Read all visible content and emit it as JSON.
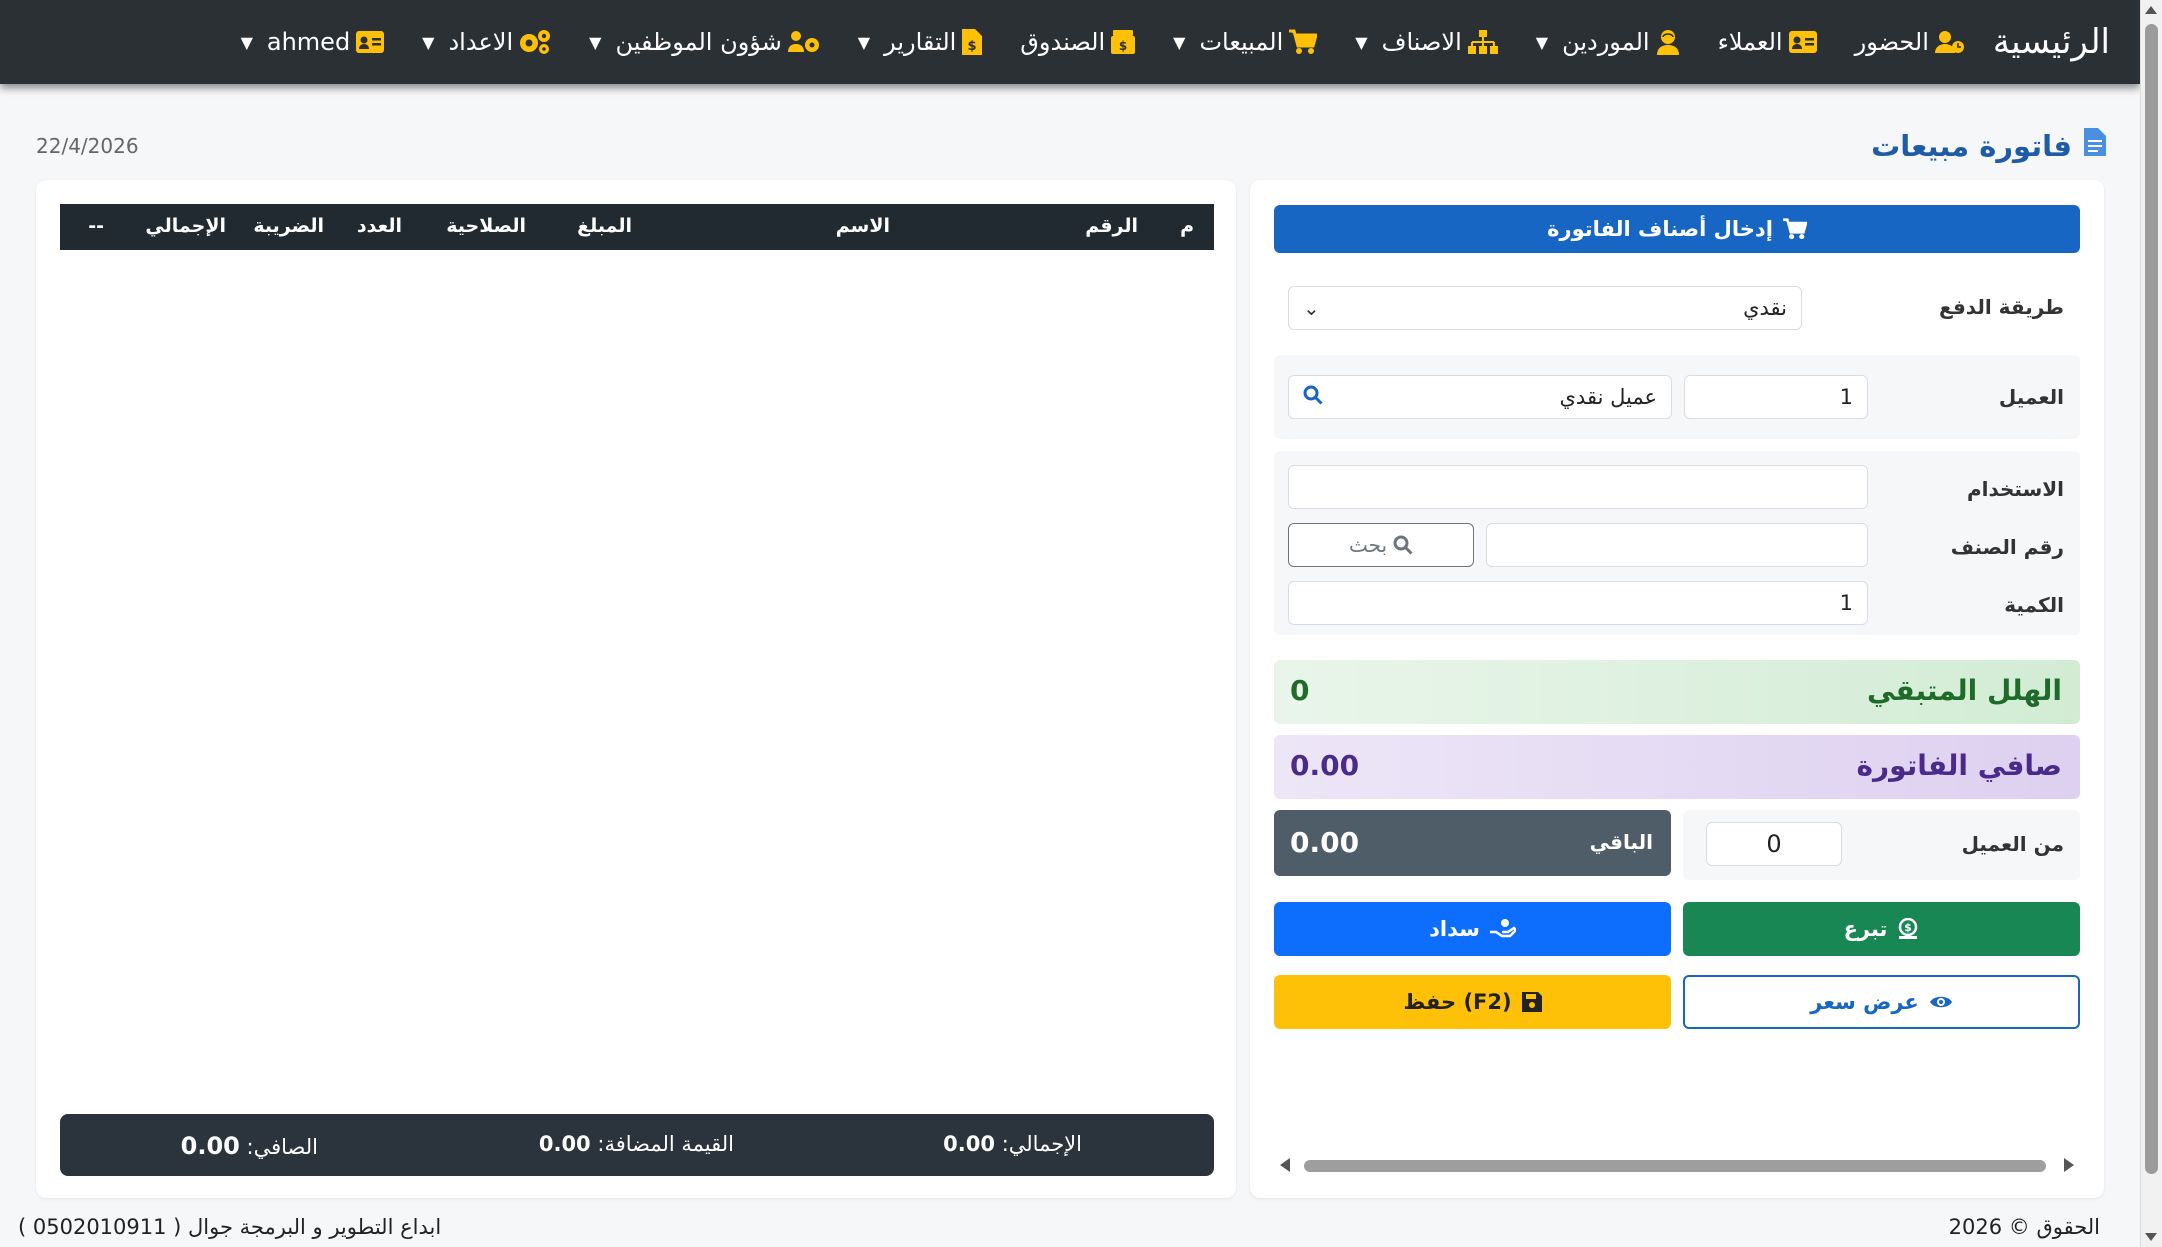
{
  "nav": {
    "brand": "الرئيسية",
    "items": [
      {
        "label": "الحضور",
        "icon": "users-clock-icon",
        "caret": false
      },
      {
        "label": "العملاء",
        "icon": "id-card-icon",
        "caret": false
      },
      {
        "label": "الموردين",
        "icon": "user-tie-icon",
        "caret": true
      },
      {
        "label": "الاصناف",
        "icon": "sitemap-icon",
        "caret": true
      },
      {
        "label": "المبيعات",
        "icon": "cart-icon",
        "caret": true
      },
      {
        "label": "الصندوق",
        "icon": "box-icon",
        "caret": false
      },
      {
        "label": "التقارير",
        "icon": "report-icon",
        "caret": true
      },
      {
        "label": "شؤون الموظفين",
        "icon": "users-cog-icon",
        "caret": true
      },
      {
        "label": "الاعداد",
        "icon": "gears-icon",
        "caret": true
      },
      {
        "label": "ahmed",
        "icon": "user-card-icon",
        "caret": true
      }
    ]
  },
  "page": {
    "title": "فاتورة مبيعات",
    "date": "22/4/2026"
  },
  "table": {
    "headers": {
      "m": "م",
      "num": "الرقم",
      "name": "الاسم",
      "amount": "المبلغ",
      "expiry": "الصلاحية",
      "count": "العدد",
      "tax": "الضريبة",
      "total": "الإجمالي",
      "actions": "--"
    }
  },
  "totals": {
    "total_label": "الإجمالي:",
    "total": "0.00",
    "vat_label": "القيمة المضافة:",
    "vat": "0.00",
    "net_label": "الصافي:",
    "net": "0.00"
  },
  "form": {
    "enter_items": "إدخال أصناف الفاتورة",
    "payment_label": "طريقة الدفع",
    "payment_value": "نقدي",
    "customer_label": "العميل",
    "customer_id": "1",
    "customer_name": "عميل نقدي",
    "barcode_label": "الاستخدام",
    "barcode_value": "",
    "item_no_label": "رقم الصنف",
    "item_no_value": "",
    "search_btn": "بحث",
    "qty_label": "الكمية",
    "qty_value": "1",
    "halal_label": "الهلل المتبقي",
    "halal_value": "0",
    "net_invoice_label": "صافي الفاتورة",
    "net_invoice_value": "0.00",
    "remaining_label": "الباقي",
    "remaining_value": "0.00",
    "from_customer_label": "من العميل",
    "from_customer_value": "0"
  },
  "buttons": {
    "donate": "تبرع",
    "pay": "سداد",
    "quote": "عرض سعر",
    "save": "(F2) حفظ"
  },
  "footer": {
    "rights": "الحقوق © 2026",
    "credit": "ابداع التطوير و البرمجة جوال ( 0502010911 )"
  },
  "colors": {
    "navbar": "#2b3035",
    "accent": "#1766c4",
    "icon": "#ffc107",
    "success": "#198754",
    "warning": "#ffc107"
  }
}
